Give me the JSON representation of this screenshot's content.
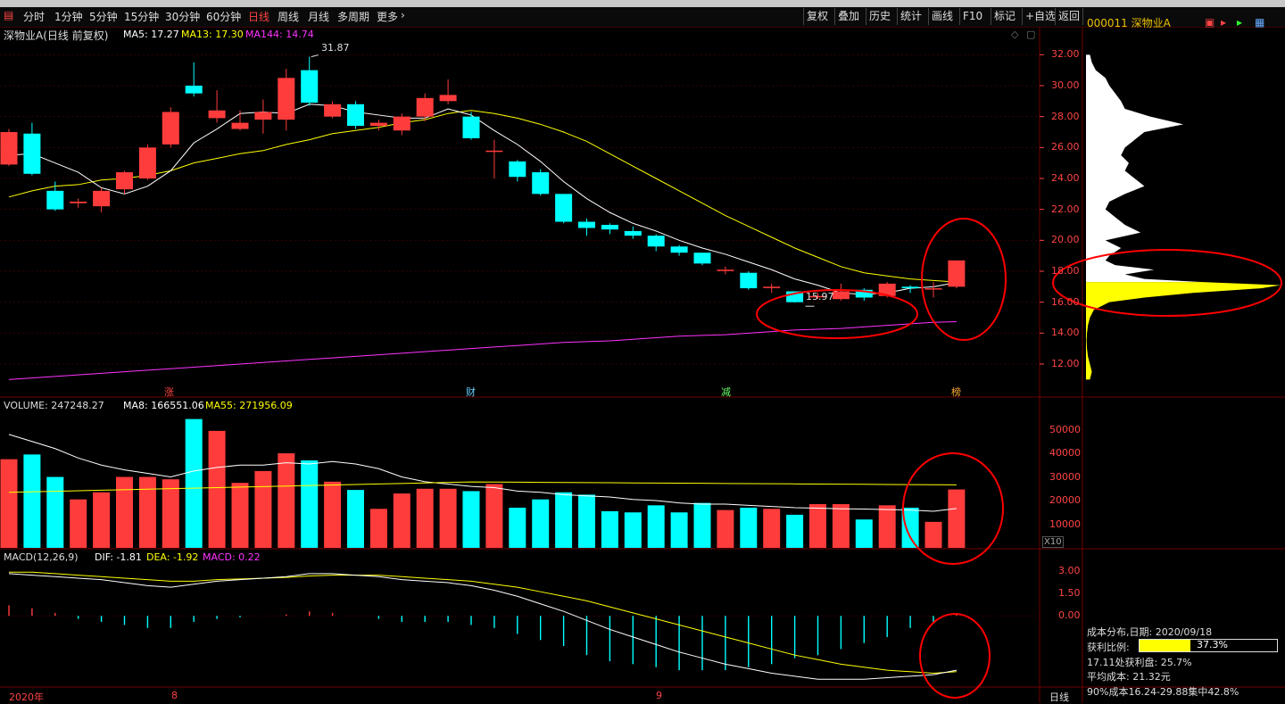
{
  "toolbar": {
    "periods": [
      "分时",
      "1分钟",
      "5分钟",
      "15分钟",
      "30分钟",
      "60分钟",
      "日线",
      "周线",
      "月线",
      "多周期",
      "更多"
    ],
    "active_period": "日线",
    "actions": [
      "复权",
      "叠加",
      "历史",
      "统计",
      "画线",
      "F10",
      "标记",
      "+自选",
      "返回"
    ]
  },
  "stock": {
    "code_name": "000011 深物业A"
  },
  "main_panel": {
    "title": "深物业A(日线 前复权)",
    "ma5_label": "MA5: 17.27",
    "ma13_label": "MA13: 17.30",
    "ma144_label": "MA144: 14.74",
    "high_label": "31.87",
    "low_label": "15.97",
    "event_markers": [
      "涨",
      "财",
      "减",
      "榜"
    ],
    "y_ticks": [
      "32.00",
      "30.00",
      "28.00",
      "26.00",
      "24.00",
      "22.00",
      "20.00",
      "18.00",
      "16.00",
      "14.00",
      "12.00"
    ]
  },
  "volume_panel": {
    "title": "VOLUME: 247248.27",
    "ma8_label": "MA8: 166551.06",
    "ma55_label": "MA55: 271956.09",
    "y_ticks": [
      "50000",
      "40000",
      "30000",
      "20000",
      "10000"
    ],
    "unit_label": "X10"
  },
  "macd_panel": {
    "title": "MACD(12,26,9)",
    "dif_label": "DIF: -1.81",
    "dea_label": "DEA: -1.92",
    "macd_label": "MACD: 0.22",
    "y_ticks": [
      "3.00",
      "1.50",
      "0.00"
    ]
  },
  "x_axis": {
    "labels": [
      "2020年",
      "8",
      "9"
    ],
    "period_label": "日线"
  },
  "cost_distribution": {
    "date_line": "成本分布,日期: 2020/09/18",
    "profit_ratio_label": "获利比例:",
    "profit_ratio_value": "37.3%",
    "profit_ratio": 0.373,
    "profit_at_line": "17.11处获利盘: 25.7%",
    "avg_cost_line": "平均成本: 21.32元",
    "range90_line": "90%成本16.24-29.88集中42.8%"
  },
  "colors": {
    "up": "#ff3c3c",
    "down": "#00ffff",
    "ma5": "#ffffff",
    "ma13": "#ffff00",
    "ma144": "#ff33ff",
    "annotation": "#ff0000"
  },
  "chart_data": {
    "type": "candlestick",
    "price": {
      "ylim": [
        10.5,
        33
      ],
      "candles": [
        {
          "o": 24.9,
          "c": 27.0,
          "h": 27.2,
          "l": 24.8
        },
        {
          "o": 26.9,
          "c": 24.3,
          "h": 27.6,
          "l": 24.2
        },
        {
          "o": 23.2,
          "c": 22.0,
          "h": 23.8,
          "l": 21.9
        },
        {
          "o": 22.4,
          "c": 22.5,
          "h": 22.7,
          "l": 22.1
        },
        {
          "o": 22.2,
          "c": 23.2,
          "h": 23.4,
          "l": 21.8
        },
        {
          "o": 23.3,
          "c": 24.4,
          "h": 24.5,
          "l": 23.0
        },
        {
          "o": 24.0,
          "c": 26.0,
          "h": 26.2,
          "l": 23.9
        },
        {
          "o": 26.2,
          "c": 28.3,
          "h": 28.6,
          "l": 26.0
        },
        {
          "o": 30.0,
          "c": 29.5,
          "h": 31.5,
          "l": 29.3
        },
        {
          "o": 27.9,
          "c": 28.4,
          "h": 29.7,
          "l": 27.6
        },
        {
          "o": 27.2,
          "c": 27.6,
          "h": 28.4,
          "l": 27.1
        },
        {
          "o": 27.8,
          "c": 28.3,
          "h": 29.1,
          "l": 26.9
        },
        {
          "o": 27.8,
          "c": 30.5,
          "h": 31.1,
          "l": 27.1
        },
        {
          "o": 31.0,
          "c": 28.9,
          "h": 31.87,
          "l": 28.7
        },
        {
          "o": 28.0,
          "c": 28.8,
          "h": 29.0,
          "l": 27.9
        },
        {
          "o": 28.8,
          "c": 27.4,
          "h": 29.0,
          "l": 27.2
        },
        {
          "o": 27.4,
          "c": 27.6,
          "h": 27.8,
          "l": 27.1
        },
        {
          "o": 27.1,
          "c": 28.0,
          "h": 28.2,
          "l": 26.8
        },
        {
          "o": 28.0,
          "c": 29.2,
          "h": 29.5,
          "l": 27.7
        },
        {
          "o": 29.0,
          "c": 29.4,
          "h": 30.4,
          "l": 28.8
        },
        {
          "o": 28.0,
          "c": 26.6,
          "h": 28.3,
          "l": 26.5
        },
        {
          "o": 25.8,
          "c": 25.8,
          "h": 26.5,
          "l": 24.0
        },
        {
          "o": 25.1,
          "c": 24.1,
          "h": 25.2,
          "l": 23.8
        },
        {
          "o": 24.4,
          "c": 23.0,
          "h": 24.6,
          "l": 22.9
        },
        {
          "o": 23.0,
          "c": 21.2,
          "h": 23.0,
          "l": 21.1
        },
        {
          "o": 21.2,
          "c": 20.8,
          "h": 21.4,
          "l": 20.3
        },
        {
          "o": 21.0,
          "c": 20.7,
          "h": 21.1,
          "l": 20.4
        },
        {
          "o": 20.6,
          "c": 20.3,
          "h": 20.9,
          "l": 20.1
        },
        {
          "o": 20.3,
          "c": 19.6,
          "h": 20.4,
          "l": 19.3
        },
        {
          "o": 19.6,
          "c": 19.2,
          "h": 19.7,
          "l": 19.0
        },
        {
          "o": 19.2,
          "c": 18.5,
          "h": 19.2,
          "l": 18.4
        },
        {
          "o": 18.1,
          "c": 18.1,
          "h": 18.3,
          "l": 17.8
        },
        {
          "o": 17.9,
          "c": 16.9,
          "h": 18.0,
          "l": 16.8
        },
        {
          "o": 17.0,
          "c": 17.0,
          "h": 17.2,
          "l": 16.6
        },
        {
          "o": 16.7,
          "c": 16.0,
          "h": 16.7,
          "l": 15.97
        },
        {
          "o": 16.4,
          "c": 16.4,
          "h": 16.6,
          "l": 16.2
        },
        {
          "o": 16.2,
          "c": 16.7,
          "h": 17.2,
          "l": 16.1
        },
        {
          "o": 16.8,
          "c": 16.3,
          "h": 16.9,
          "l": 16.1
        },
        {
          "o": 16.4,
          "c": 17.2,
          "h": 17.3,
          "l": 16.3
        },
        {
          "o": 17.0,
          "c": 16.9,
          "h": 17.1,
          "l": 16.6
        },
        {
          "o": 16.9,
          "c": 16.9,
          "h": 17.3,
          "l": 16.3
        },
        {
          "o": 17.0,
          "c": 18.7,
          "h": 18.7,
          "l": 16.9
        }
      ],
      "ma5": [
        25.5,
        25.6,
        25.0,
        24.4,
        23.4,
        23.0,
        23.5,
        24.5,
        26.3,
        27.2,
        28.2,
        28.3,
        28.2,
        28.8,
        28.7,
        28.3,
        28.1,
        27.9,
        27.9,
        28.5,
        28.1,
        27.1,
        26.2,
        25.1,
        23.8,
        22.7,
        21.8,
        21.1,
        20.6,
        20.0,
        19.5,
        19.1,
        18.6,
        18.1,
        17.5,
        17.1,
        16.6,
        16.5,
        16.6,
        16.9,
        17.0,
        17.27
      ],
      "ma13": [
        22.8,
        23.2,
        23.5,
        23.6,
        23.9,
        24.0,
        24.2,
        24.5,
        25.0,
        25.3,
        25.6,
        25.8,
        26.2,
        26.5,
        26.9,
        27.1,
        27.3,
        27.6,
        27.8,
        28.2,
        28.4,
        28.2,
        27.9,
        27.5,
        27.0,
        26.4,
        25.6,
        24.8,
        24.0,
        23.2,
        22.4,
        21.6,
        20.9,
        20.2,
        19.5,
        18.9,
        18.3,
        17.9,
        17.7,
        17.5,
        17.4,
        17.3
      ],
      "ma144": [
        11.0,
        11.1,
        11.2,
        11.3,
        11.4,
        11.5,
        11.6,
        11.7,
        11.8,
        11.9,
        12.0,
        12.1,
        12.2,
        12.3,
        12.4,
        12.5,
        12.6,
        12.7,
        12.8,
        12.9,
        13.0,
        13.1,
        13.2,
        13.3,
        13.4,
        13.45,
        13.5,
        13.6,
        13.7,
        13.8,
        13.85,
        13.9,
        14.0,
        14.1,
        14.2,
        14.25,
        14.3,
        14.4,
        14.5,
        14.6,
        14.7,
        14.74
      ]
    },
    "volume": {
      "ylim": [
        0,
        57000
      ],
      "values": [
        37500,
        39500,
        30000,
        20500,
        23500,
        30000,
        30000,
        29000,
        54500,
        49500,
        27500,
        32500,
        40000,
        37000,
        28000,
        24500,
        16500,
        23000,
        25000,
        25000,
        24000,
        27000,
        17000,
        20500,
        23500,
        22500,
        15500,
        15000,
        18000,
        15000,
        19000,
        16000,
        17000,
        16500,
        14000,
        18500,
        18500,
        12000,
        18000,
        17000,
        11000,
        24700
      ],
      "ma8": [
        48000,
        45000,
        42000,
        38000,
        35000,
        33000,
        31500,
        30000,
        32500,
        34000,
        35000,
        35000,
        36000,
        35500,
        36500,
        35500,
        33500,
        30000,
        28000,
        27000,
        26000,
        25500,
        24000,
        23500,
        22500,
        22000,
        21500,
        20500,
        20000,
        19000,
        18500,
        18500,
        18000,
        17500,
        17000,
        16800,
        16500,
        16400,
        16200,
        16000,
        15500,
        16655
      ]
    },
    "macd": {
      "ylim": [
        -4.6,
        3.8
      ],
      "dif": [
        2.8,
        2.7,
        2.6,
        2.5,
        2.4,
        2.2,
        2.0,
        1.9,
        2.1,
        2.3,
        2.4,
        2.5,
        2.6,
        2.8,
        2.8,
        2.7,
        2.6,
        2.4,
        2.3,
        2.2,
        2.0,
        1.7,
        1.3,
        0.8,
        0.3,
        -0.3,
        -0.9,
        -1.4,
        -1.9,
        -2.4,
        -2.8,
        -3.2,
        -3.5,
        -3.8,
        -4.0,
        -4.2,
        -4.2,
        -4.2,
        -4.1,
        -4.0,
        -3.9,
        -3.6
      ],
      "dea": [
        2.9,
        2.9,
        2.8,
        2.7,
        2.6,
        2.5,
        2.4,
        2.3,
        2.3,
        2.4,
        2.45,
        2.5,
        2.55,
        2.65,
        2.7,
        2.7,
        2.7,
        2.6,
        2.5,
        2.4,
        2.3,
        2.1,
        1.9,
        1.6,
        1.3,
        1.0,
        0.6,
        0.2,
        -0.2,
        -0.6,
        -1.0,
        -1.4,
        -1.8,
        -2.2,
        -2.6,
        -2.9,
        -3.2,
        -3.4,
        -3.6,
        -3.7,
        -3.8,
        -3.7
      ],
      "hist": [
        0.7,
        0.5,
        0.2,
        -0.2,
        -0.4,
        -0.6,
        -0.8,
        -0.8,
        -0.4,
        -0.2,
        -0.1,
        0.0,
        0.1,
        0.3,
        0.2,
        0.0,
        -0.2,
        -0.4,
        -0.4,
        -0.4,
        -0.6,
        -0.8,
        -1.2,
        -1.6,
        -2.0,
        -2.6,
        -3.0,
        -3.2,
        -3.4,
        -3.6,
        -3.6,
        -3.6,
        -3.4,
        -3.2,
        -2.8,
        -2.6,
        -2.2,
        -1.8,
        -1.4,
        -0.8,
        -0.4,
        0.2
      ]
    },
    "volume_profile": {
      "price_levels": [
        11.0,
        11.5,
        12.0,
        12.5,
        13.0,
        13.5,
        14.0,
        14.5,
        15.0,
        15.5,
        16.0,
        16.3,
        16.6,
        16.9,
        17.1,
        17.3,
        17.5,
        17.8,
        18.1,
        18.4,
        18.7,
        19.0,
        19.5,
        20.0,
        20.5,
        21.0,
        21.5,
        22.0,
        22.5,
        23.0,
        23.5,
        24.0,
        24.5,
        25.0,
        25.5,
        26.0,
        26.5,
        27.0,
        27.5,
        28.0,
        28.5,
        29.0,
        29.5,
        30.0,
        30.5,
        31.0,
        31.5,
        32.0
      ],
      "weights": [
        0.02,
        0.03,
        0.02,
        0.01,
        0.005,
        0.003,
        0.005,
        0.01,
        0.02,
        0.04,
        0.12,
        0.3,
        0.55,
        0.9,
        1.0,
        0.6,
        0.3,
        0.2,
        0.35,
        0.15,
        0.1,
        0.12,
        0.18,
        0.1,
        0.28,
        0.2,
        0.15,
        0.1,
        0.12,
        0.2,
        0.3,
        0.25,
        0.2,
        0.22,
        0.18,
        0.2,
        0.25,
        0.3,
        0.5,
        0.33,
        0.2,
        0.18,
        0.15,
        0.12,
        0.1,
        0.05,
        0.03,
        0.02
      ]
    }
  }
}
